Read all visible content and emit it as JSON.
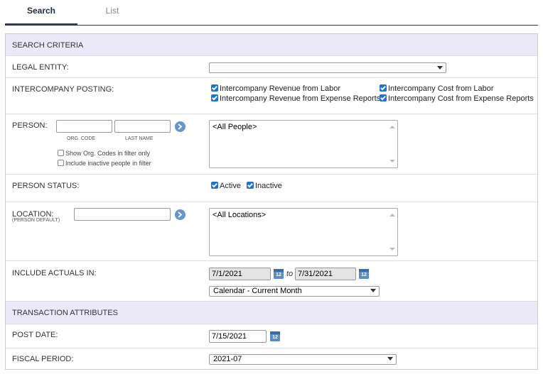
{
  "tabs": {
    "search": "Search",
    "list": "List"
  },
  "sections": {
    "criteria": "SEARCH CRITERIA",
    "transaction": "TRANSACTION ATTRIBUTES"
  },
  "legal_entity": {
    "label": "LEGAL ENTITY:",
    "value": ""
  },
  "intercompany": {
    "label": "INTERCOMPANY POSTING:",
    "options": [
      {
        "label": "Intercompany Revenue from Labor",
        "checked": true
      },
      {
        "label": "Intercompany Cost from Labor",
        "checked": true
      },
      {
        "label": "Intercompany Revenue from Expense Reports",
        "checked": true
      },
      {
        "label": "Intercompany Cost from Expense Reports",
        "checked": true
      }
    ]
  },
  "person": {
    "label": "PERSON:",
    "org_code_caption": "ORG. CODE",
    "last_name_caption": "LAST NAME",
    "org_code_value": "",
    "last_name_value": "",
    "show_org_codes": "Show Org. Codes in filter only",
    "include_inactive": "Include inactive people in filter",
    "list_item": "<All People>"
  },
  "person_status": {
    "label": "PERSON STATUS:",
    "active": "Active",
    "inactive": "Inactive"
  },
  "location": {
    "label": "LOCATION:",
    "sublabel": "(PERSON DEFAULT)",
    "value": "",
    "list_item": "<All Locations>"
  },
  "actuals": {
    "label": "INCLUDE ACTUALS IN:",
    "from": "7/1/2021",
    "to_label": "to",
    "to": "7/31/2021",
    "calendar_icon_text": "12",
    "period": "Calendar - Current Month"
  },
  "post_date": {
    "label": "POST DATE:",
    "value": "7/15/2021"
  },
  "fiscal_period": {
    "label": "FISCAL PERIOD:",
    "value": "2021-07"
  },
  "colors": {
    "accent": "#2b3a55",
    "section_bg": "#ebe8f7",
    "checkbox": "#1e72d2",
    "go_button": "#6a93c8"
  }
}
